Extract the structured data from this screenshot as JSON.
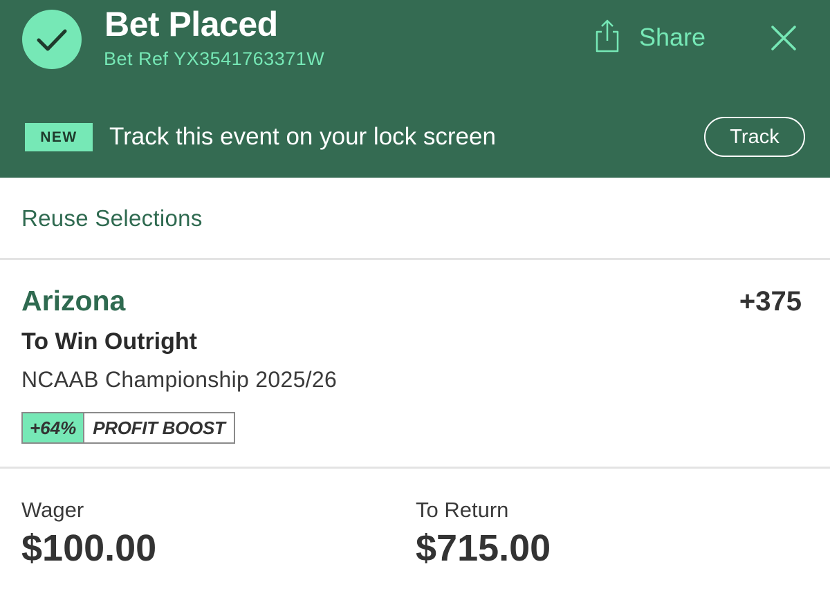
{
  "header": {
    "title": "Bet Placed",
    "bet_ref": "Bet Ref YX3541763371W",
    "share_label": "Share",
    "check_icon": "check-icon",
    "close_icon": "close-icon",
    "share_icon": "share-icon"
  },
  "track_banner": {
    "badge": "NEW",
    "text": "Track this event on your lock screen",
    "button_label": "Track"
  },
  "reuse_label": "Reuse Selections",
  "selection": {
    "team": "Arizona",
    "odds": "+375",
    "market": "To Win Outright",
    "event": "NCAAB Championship 2025/26",
    "boost_percent": "+64%",
    "boost_label": "PROFIT BOOST"
  },
  "wager": {
    "label": "Wager",
    "amount": "$100.00"
  },
  "to_return": {
    "label": "To Return",
    "amount": "$715.00"
  },
  "colors": {
    "header_bg": "#346b52",
    "accent": "#76e8b6",
    "brand_text": "#2f6a50"
  }
}
